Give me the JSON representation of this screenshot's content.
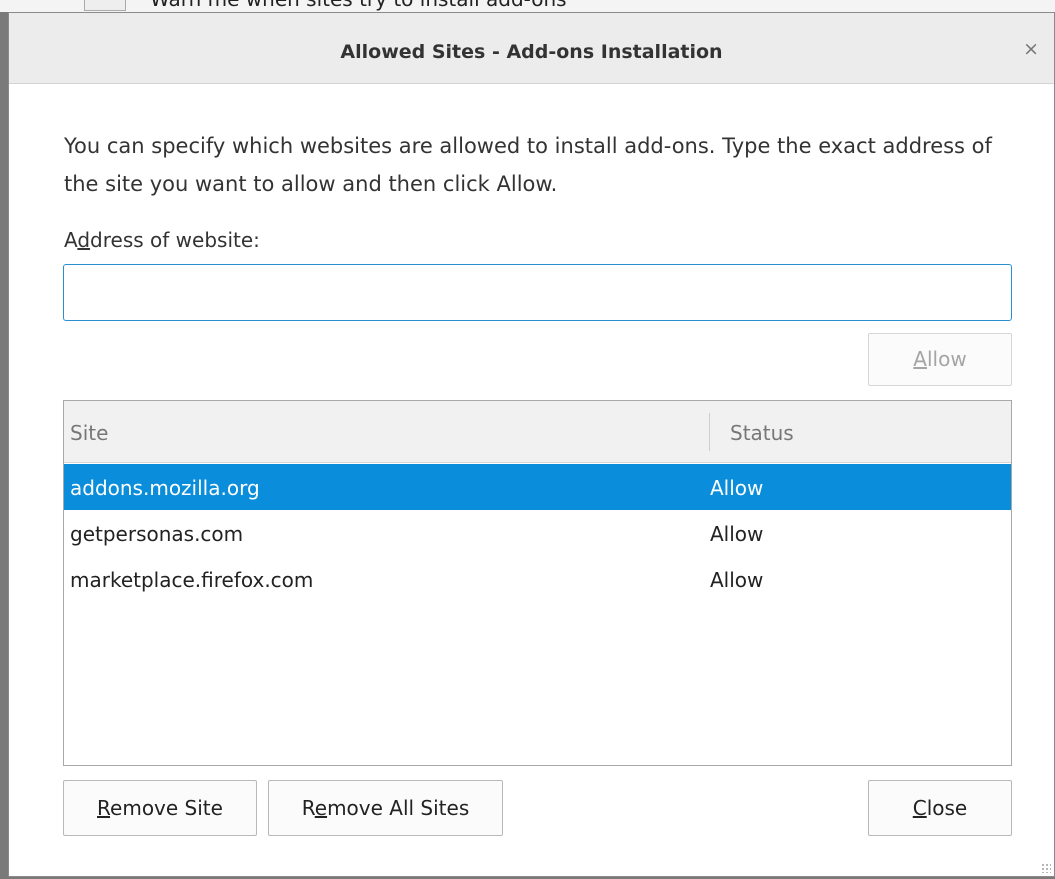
{
  "backdrop": {
    "partial_text": "Warn me when sites try to install add-ons"
  },
  "dialog": {
    "title": "Allowed Sites - Add-ons Installation",
    "close_glyph": "×",
    "description": "You can specify which websites are allowed to install add-ons. Type the exact address of the site you want to allow and then click Allow.",
    "address_label_accesskey": "d",
    "address_label_pre": "A",
    "address_label_post": "dress of website:",
    "address_input": {
      "value": "",
      "placeholder": ""
    },
    "allow_button": {
      "accesskey": "A",
      "rest": "llow",
      "enabled": false
    }
  },
  "table": {
    "columns": [
      "Site",
      "Status"
    ],
    "rows": [
      {
        "site": "addons.mozilla.org",
        "status": "Allow",
        "selected": true
      },
      {
        "site": "getpersonas.com",
        "status": "Allow",
        "selected": false
      },
      {
        "site": "marketplace.firefox.com",
        "status": "Allow",
        "selected": false
      }
    ]
  },
  "buttons": {
    "remove_site": {
      "accesskey": "R",
      "rest": "emove Site"
    },
    "remove_all_pre": "R",
    "remove_all_accesskey": "e",
    "remove_all_post": "move All Sites",
    "close": {
      "accesskey": "C",
      "rest": "lose"
    }
  },
  "colors": {
    "selection": "#0a8ddb",
    "input_focus_border": "#2a8fd1"
  }
}
